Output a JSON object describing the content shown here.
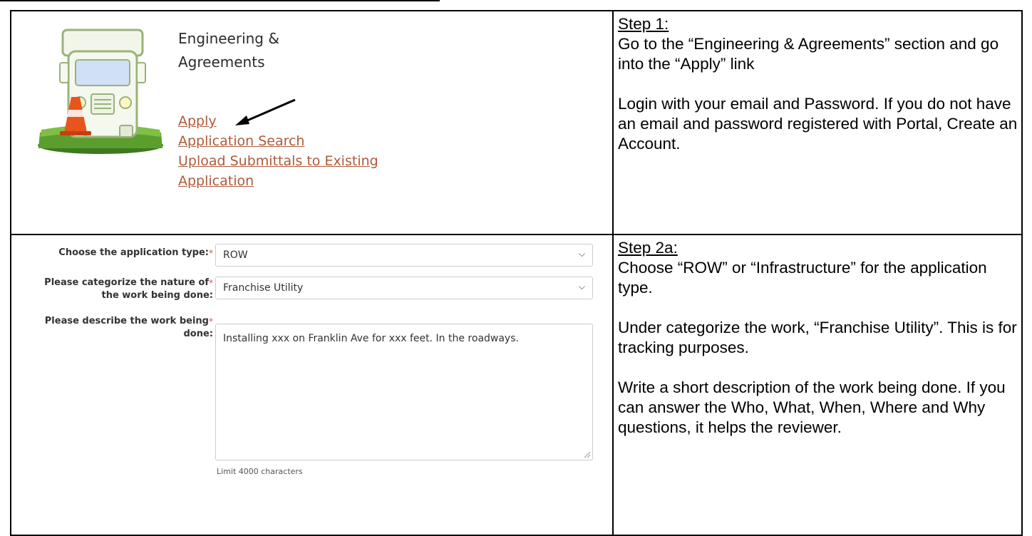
{
  "step1": {
    "section_title_line1": "Engineering &",
    "section_title_line2": "Agreements",
    "links": [
      "Apply",
      "Application Search",
      "Upload Submittals to Existing",
      "Application"
    ],
    "step_label": "Step 1:",
    "text1": "Go to the “Engineering & Agreements” section and go into the “Apply” link",
    "text2": "Login with your email and Password.  If you do not have an email and password registered with Portal, Create an Account."
  },
  "step2": {
    "app_type_label": "Choose the application type:",
    "app_type_value": "ROW",
    "nature_label_line1": "Please categorize the nature of",
    "nature_label_line2": "the work being done:",
    "nature_value": "Franchise Utility",
    "describe_label_line1": "Please describe the work being",
    "describe_label_line2": "done:",
    "describe_value": "Installing xxx on Franklin Ave for xxx feet.  In the roadways.",
    "limit_text": "Limit 4000 characters",
    "required_mark": "*",
    "step_label": "Step 2a:",
    "text1": "Choose “ROW” or “Infrastructure” for the application type.",
    "text2": "Under categorize the work, “Franchise Utility”.  This is for tracking purposes.",
    "text3": "Write a short description of the work being done.  If you can answer the Who, What, When, Where and Why questions, it helps the reviewer."
  },
  "icons": [
    "dump-truck-icon",
    "traffic-cone-icon",
    "arrow-icon",
    "chevron-down-icon",
    "resize-grip-icon"
  ],
  "colors": {
    "link": "#b05a3a",
    "required": "#d9534f",
    "grass": "#5c9e2e",
    "cone": "#e8541c"
  }
}
